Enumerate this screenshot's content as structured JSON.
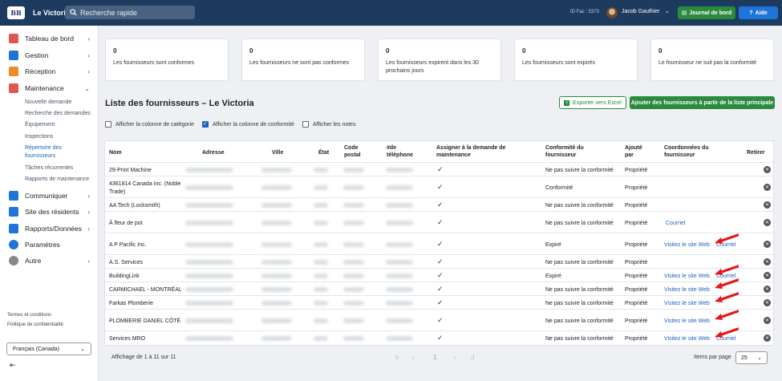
{
  "topbar": {
    "logo_text": "BB",
    "brand": "Le Victoria",
    "search_placeholder": "Recherche rapide",
    "id_fac": "ID Fac : 5373",
    "user_name": "Jacob Gauthier",
    "journal_label": "Journal de bord",
    "aide_label": "Aide"
  },
  "sidebar": {
    "items": [
      {
        "label": "Tableau de bord",
        "icon": "dashboard-icon",
        "color": "#e0574f"
      },
      {
        "label": "Gestion",
        "icon": "building-icon",
        "color": "#1e74d9"
      },
      {
        "label": "Réception",
        "icon": "bell-icon",
        "color": "#f08a24"
      },
      {
        "label": "Maintenance",
        "icon": "wrench-icon",
        "color": "#e0574f"
      }
    ],
    "sub_items": [
      "Nouvelle demande",
      "Recherche des demandes",
      "Équipement",
      "Inspections",
      "Répertoire des",
      "fournisseurs",
      "Tâches récurrentes",
      "Rapports de maintenance"
    ],
    "items2": [
      {
        "label": "Communiquer",
        "icon": "megaphone-icon",
        "color": "#1e74d9"
      },
      {
        "label": "Site des résidents",
        "icon": "grid-icon",
        "color": "#1e74d9"
      },
      {
        "label": "Rapports/Données",
        "icon": "chart-icon",
        "color": "#1e74d9"
      },
      {
        "label": "Paramètres",
        "icon": "gear-icon",
        "color": "#1e74d9"
      },
      {
        "label": "Autre",
        "icon": "more-icon",
        "color": "#888888"
      }
    ],
    "terms": "Termes et conditions",
    "privacy": "Politique de confidentialité",
    "language": "Français (Canada)"
  },
  "cards": [
    {
      "num": "0",
      "label": "Les fournisseurs sont conformes"
    },
    {
      "num": "0",
      "label": "Les fournisseurs ne sont pas conformes"
    },
    {
      "num": "0",
      "label": "Les fournisseurs expirent dans les 30 prochains jours"
    },
    {
      "num": "0",
      "label": "Les fournisseurs sont expirés"
    },
    {
      "num": "0",
      "label": "Le fournisseur ne suit pas la conformité"
    }
  ],
  "list": {
    "title": "Liste des fournisseurs – Le Victoria",
    "export_label": "Exporter vers Excel",
    "add_label": "Ajouter des fournisseurs à partir de la liste principale",
    "opt_category": "Afficher la colonne de catégorie",
    "opt_compliance": "Afficher la colonne de conformité",
    "opt_notes": "Afficher les notes"
  },
  "table": {
    "headers": {
      "nom": "Nom",
      "adresse": "Adresse",
      "ville": "Ville",
      "etat": "État",
      "code1": "Code",
      "code2": "postal",
      "tel1": "#de",
      "tel2": "téléphone",
      "assign1": "Assigner à la demande de",
      "assign2": "maintenance",
      "conf1": "Conformité du",
      "conf2": "fournisseur",
      "ajoute1": "Ajouté",
      "ajoute2": "par",
      "coord1": "Coordonnées du",
      "coord2": "fournisseur",
      "retirer": "Retirer"
    },
    "rows": [
      {
        "name": "29-Print Machine",
        "name2": "",
        "conformity": "Ne pas suivre la conformité",
        "added_by": "Propriété",
        "web": "",
        "email": ""
      },
      {
        "name": "4361814 Canada Inc. (Noble",
        "name2": "Trade)",
        "conformity": "Conformité",
        "added_by": "Propriété",
        "web": "",
        "email": ""
      },
      {
        "name": "AA Tech (Locksmith)",
        "name2": "",
        "conformity": "Ne pas suivre la conformité",
        "added_by": "Propriété",
        "web": "",
        "email": ""
      },
      {
        "name": "À fleur de pot",
        "name2": "",
        "conformity": "Ne pas suivre la conformité",
        "added_by": "Propriété",
        "web": "",
        "email": "Courriel"
      },
      {
        "name": "A P Pacific Inc.",
        "name2": "",
        "conformity": "Expiré",
        "added_by": "Propriété",
        "web": "Visitez le site Web",
        "email": "Courriel"
      },
      {
        "name": "A.S. Services",
        "name2": "",
        "conformity": "Ne pas suivre la conformité",
        "added_by": "Propriété",
        "web": "",
        "email": ""
      },
      {
        "name": "BuildingLink",
        "name2": "",
        "conformity": "Expiré",
        "added_by": "Propriété",
        "web": "Visitez le site Web",
        "email": "Courriel"
      },
      {
        "name": "CARMICHAEL - MONTRÉAL",
        "name2": "",
        "conformity": "Ne pas suivre la conformité",
        "added_by": "Propriété",
        "web": "Visitez le site Web",
        "email": ""
      },
      {
        "name": "Farkas Plomberie",
        "name2": "",
        "conformity": "Ne pas suivre la conformité",
        "added_by": "Propriété",
        "web": "Visitez le site Web",
        "email": ""
      },
      {
        "name": "PLOMBERIE DANIEL CÔTÉ",
        "name2": "",
        "conformity": "Ne pas suivre la conformité",
        "added_by": "Propriété",
        "web": "Visitez le site Web",
        "email": ""
      },
      {
        "name": "Services MRO",
        "name2": "",
        "conformity": "Ne pas suivre la conformité",
        "added_by": "Propriété",
        "web": "Visitez le site Web",
        "email": "Courriel"
      }
    ]
  },
  "footer": {
    "info": "Affichage de 1 à 11 sur 11",
    "page": "1",
    "ipp_label": "Items par page",
    "ipp_value": "25"
  }
}
